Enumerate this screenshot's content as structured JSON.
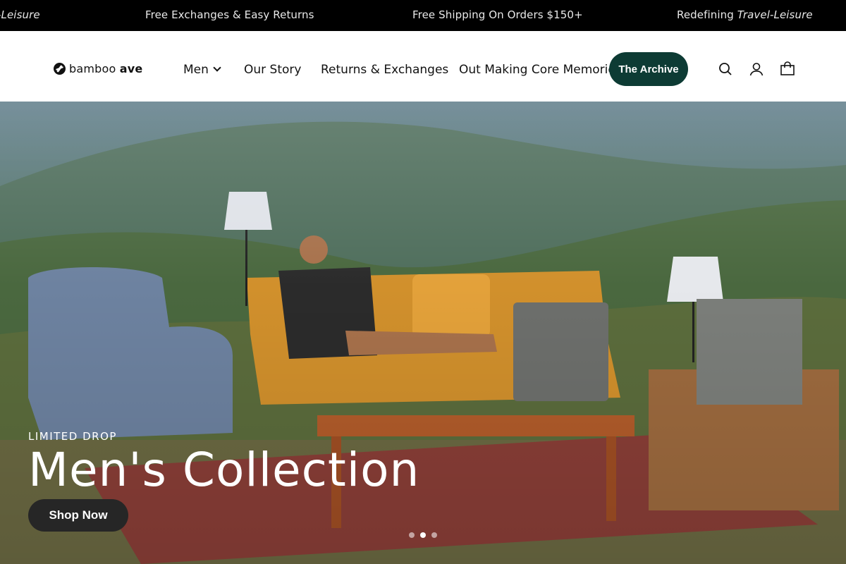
{
  "announcement": {
    "items": [
      {
        "prefix": "",
        "emphasis": "-Leisure"
      },
      {
        "prefix": "Free Exchanges & Easy Returns",
        "emphasis": ""
      },
      {
        "prefix": "Free Shipping On Orders $150+",
        "emphasis": ""
      },
      {
        "prefix": "Redefining ",
        "emphasis": "Travel-Leisure"
      }
    ]
  },
  "header": {
    "logo": {
      "text_light": "bamboo ",
      "text_bold": "ave",
      "icon": "bamboo-logo-icon"
    },
    "nav": [
      {
        "label": "Men",
        "has_dropdown": true
      },
      {
        "label": "Our Story"
      },
      {
        "label": "Returns & Exchanges"
      },
      {
        "label": "Out Making Core Memories"
      }
    ],
    "archive_button": "The Archive",
    "icons": [
      "search-icon",
      "account-icon",
      "cart-icon"
    ]
  },
  "hero": {
    "kicker": "LIMITED DROP",
    "title": "Men's Collection",
    "cta": "Shop Now",
    "slides_total": 3,
    "active_slide": 2
  },
  "colors": {
    "announcement_bg": "#000000",
    "archive_button_bg": "#0d3b34",
    "cta_bg": "#262626"
  }
}
